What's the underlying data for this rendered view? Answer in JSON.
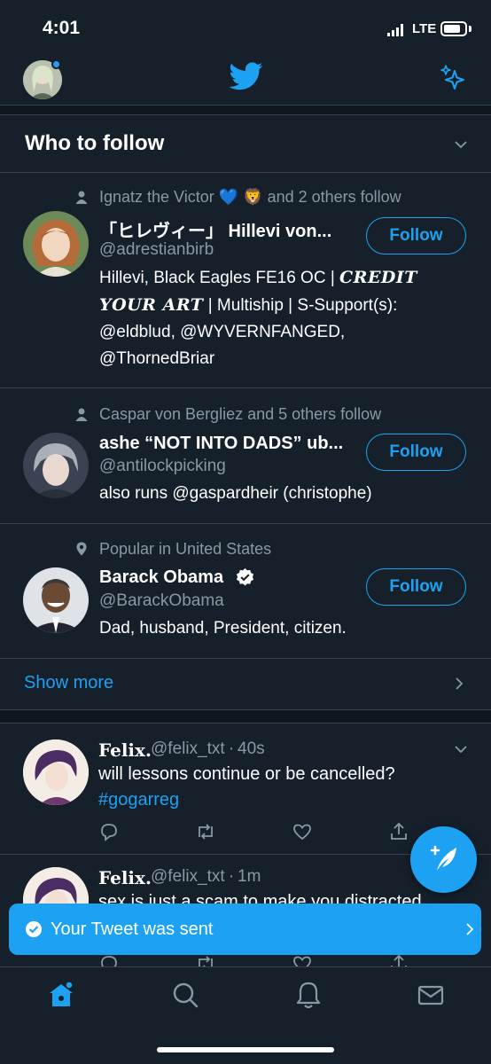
{
  "status_bar": {
    "time": "4:01",
    "network": "LTE"
  },
  "top_nav": {
    "avatar_icon": "profile-avatar",
    "logo_icon": "twitter-bird-icon",
    "sparkle_icon": "sparkle-icon"
  },
  "who_to_follow": {
    "title": "Who to follow",
    "suggestions": [
      {
        "context": "Ignatz the Victor 💙 🦁 and 2 others follow",
        "name": "「ヒレヴィー」 Hillevi von...",
        "handle": "@adrestianbirb",
        "bio_plain": "Hillevi, Black Eagles FE16 OC | ",
        "bio_styled": "CREDIT YOUR ART",
        "bio_rest": " | Multiship | S-Support(s): @eldblud, @WYVERNFANGED, @ThornedBriar",
        "follow_label": "Follow"
      },
      {
        "context": "Caspar von Bergliez and 5 others follow",
        "name": "ashe “NOT INTO DADS” ub...",
        "handle": "@antilockpicking",
        "bio": "also runs @gaspardheir (christophe)",
        "follow_label": "Follow"
      },
      {
        "context": "Popular in United States",
        "name": "Barack Obama",
        "handle": "@BarackObama",
        "bio": "Dad, husband, President, citizen.",
        "follow_label": "Follow"
      }
    ],
    "show_more": "Show more"
  },
  "tweets": [
    {
      "name": "Felix.",
      "handle": "@felix_txt",
      "separator": "·",
      "time": "40s",
      "text": "will lessons continue or be cancelled?",
      "hashtag": "#gogarreg"
    },
    {
      "name": "Felix.",
      "handle": "@felix_txt",
      "separator": "·",
      "time": "1m",
      "text": "sex is just a scam to make you distracted"
    }
  ],
  "toast": {
    "message": "Your Tweet was sent"
  },
  "tab_bar": {
    "items": [
      "home-icon",
      "search-icon",
      "notifications-icon",
      "messages-icon"
    ]
  },
  "colors": {
    "background": "#15202b",
    "accent": "#1da1f2",
    "secondary_text": "#8899a6",
    "divider": "#38444d"
  }
}
